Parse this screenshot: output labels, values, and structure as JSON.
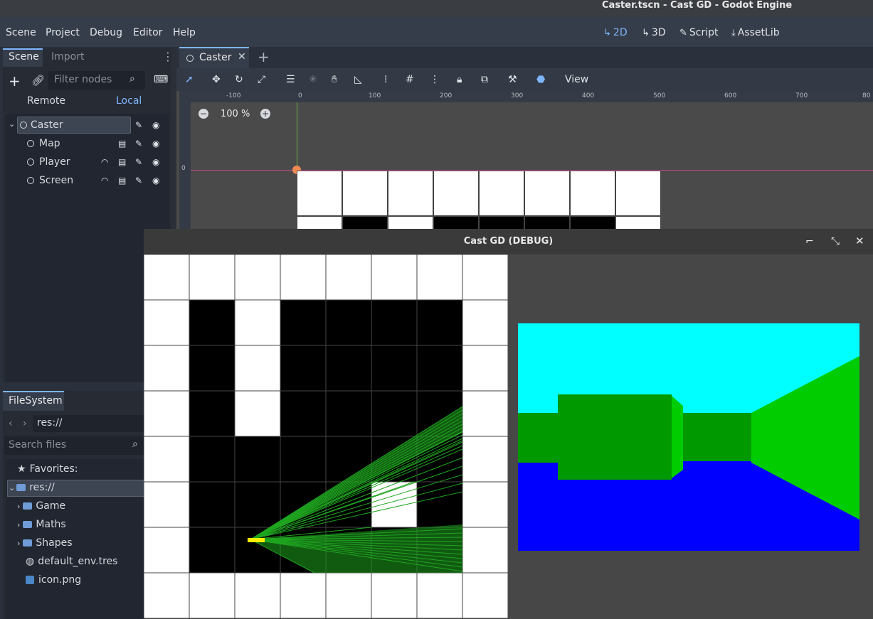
{
  "window": {
    "title": "Caster.tscn - Cast GD - Godot Engine"
  },
  "menu": {
    "items": [
      "Scene",
      "Project",
      "Debug",
      "Editor",
      "Help"
    ]
  },
  "modes": {
    "items": [
      "2D",
      "3D",
      "Script",
      "AssetLib"
    ],
    "active": "2D"
  },
  "scene_dock": {
    "tabs": [
      "Scene",
      "Import"
    ],
    "filter_placeholder": "Filter nodes",
    "remote_label": "Remote",
    "local_label": "Local",
    "tree": [
      {
        "name": "Caster",
        "icons": [
          "script-icon",
          "eye-icon"
        ]
      },
      {
        "name": "Map",
        "icons": [
          "clapper-icon",
          "script-icon",
          "eye-icon"
        ]
      },
      {
        "name": "Player",
        "icons": [
          "signal-icon",
          "clapper-icon",
          "script-icon",
          "eye-icon"
        ]
      },
      {
        "name": "Screen",
        "icons": [
          "signal-icon",
          "clapper-icon",
          "script-icon",
          "eye-icon"
        ]
      }
    ]
  },
  "filesystem": {
    "tab": "FileSystem",
    "path": "res://",
    "search_placeholder": "Search files",
    "favorites_label": "Favorites:",
    "root": "res://",
    "items": [
      {
        "name": "Game",
        "kind": "folder"
      },
      {
        "name": "Maths",
        "kind": "folder"
      },
      {
        "name": "Shapes",
        "kind": "folder"
      },
      {
        "name": "default_env.tres",
        "kind": "resource"
      },
      {
        "name": "icon.png",
        "kind": "image"
      }
    ]
  },
  "editor": {
    "tab": "Caster",
    "view_menu": "View",
    "zoom": "100 %",
    "ruler_labels": [
      "-100",
      "0",
      "100",
      "200",
      "300",
      "400",
      "500",
      "600",
      "700",
      "80"
    ],
    "ruler_left_label": "0"
  },
  "debug_window": {
    "title": "Cast GD (DEBUG)",
    "map": [
      [
        1,
        1,
        1,
        1,
        1,
        1,
        1,
        1
      ],
      [
        1,
        0,
        1,
        0,
        0,
        0,
        0,
        1
      ],
      [
        1,
        0,
        1,
        0,
        0,
        0,
        0,
        1
      ],
      [
        1,
        0,
        1,
        0,
        0,
        0,
        0,
        1
      ],
      [
        1,
        0,
        0,
        0,
        0,
        0,
        0,
        1
      ],
      [
        1,
        0,
        0,
        0,
        0,
        1,
        0,
        1
      ],
      [
        1,
        0,
        0,
        0,
        0,
        0,
        0,
        1
      ],
      [
        1,
        1,
        1,
        1,
        1,
        1,
        1,
        1
      ]
    ],
    "colors": {
      "sky": "#00ffff",
      "floor": "#0000ff",
      "wall_dark": "#009900",
      "wall_light": "#00cc00",
      "ray": "#1fa51f",
      "player": "#ffee00"
    }
  }
}
